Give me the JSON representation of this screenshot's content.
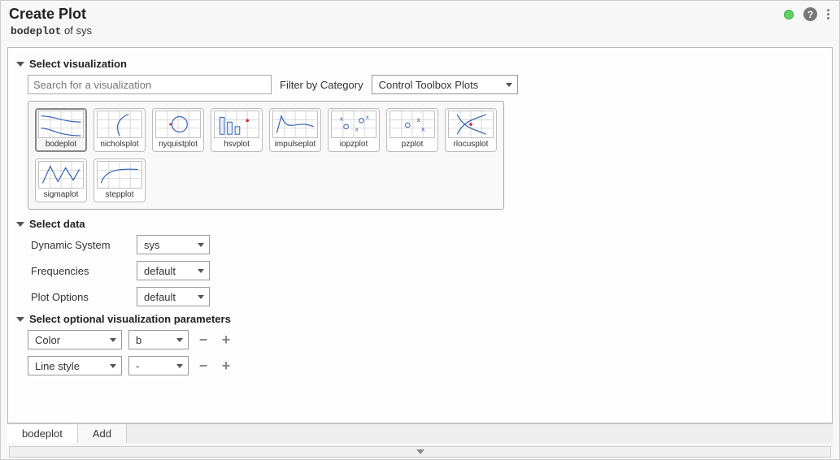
{
  "header": {
    "title": "Create Plot",
    "subtitle_code": "bodeplot",
    "subtitle_mid": " of ",
    "subtitle_target": "sys"
  },
  "sections": {
    "select_viz_label": "Select visualization",
    "search_placeholder": "Search for a visualization",
    "filter_label": "Filter by Category",
    "filter_value": "Control Toolbox Plots",
    "select_data_label": "Select data",
    "optional_params_label": "Select optional visualization parameters"
  },
  "viz_items": [
    {
      "label": "bodeplot",
      "selected": true
    },
    {
      "label": "nicholsplot",
      "selected": false
    },
    {
      "label": "nyquistplot",
      "selected": false
    },
    {
      "label": "hsvplot",
      "selected": false
    },
    {
      "label": "impulseplot",
      "selected": false
    },
    {
      "label": "iopzplot",
      "selected": false
    },
    {
      "label": "pzplot",
      "selected": false
    },
    {
      "label": "rlocusplot",
      "selected": false
    },
    {
      "label": "sigmaplot",
      "selected": false
    },
    {
      "label": "stepplot",
      "selected": false
    }
  ],
  "data_rows": {
    "dynamic_system_label": "Dynamic System",
    "dynamic_system_value": "sys",
    "frequencies_label": "Frequencies",
    "frequencies_value": "default",
    "plot_options_label": "Plot Options",
    "plot_options_value": "default"
  },
  "param_rows": [
    {
      "name": "Color",
      "value": "b"
    },
    {
      "name": "Line style",
      "value": "-"
    }
  ],
  "tabs": [
    {
      "label": "bodeplot",
      "active": true
    },
    {
      "label": "Add",
      "active": false
    }
  ],
  "icons": {
    "help_glyph": "?",
    "minus": "−",
    "plus": "+"
  }
}
